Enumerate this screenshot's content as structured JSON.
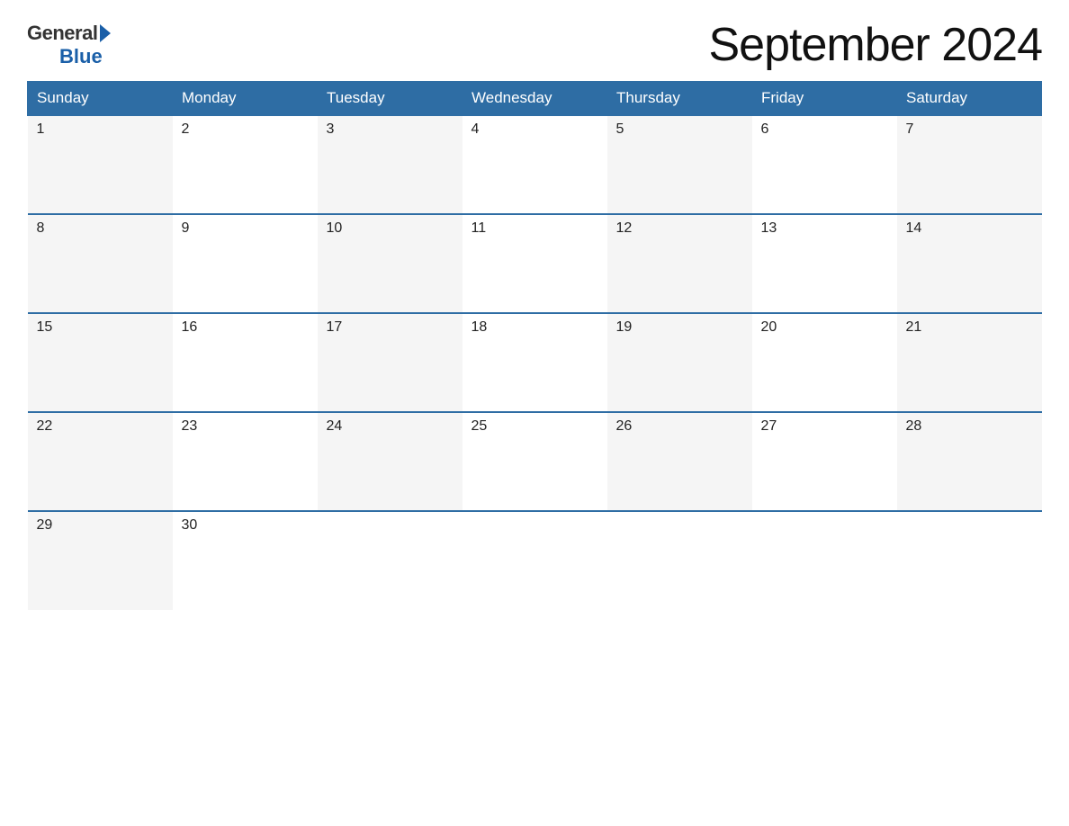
{
  "logo": {
    "general_text": "General",
    "blue_text": "Blue",
    "bottom_blue": "Blue"
  },
  "title": "September 2024",
  "days_of_week": [
    "Sunday",
    "Monday",
    "Tuesday",
    "Wednesday",
    "Thursday",
    "Friday",
    "Saturday"
  ],
  "weeks": [
    [
      {
        "day": "1",
        "empty": false
      },
      {
        "day": "2",
        "empty": false
      },
      {
        "day": "3",
        "empty": false
      },
      {
        "day": "4",
        "empty": false
      },
      {
        "day": "5",
        "empty": false
      },
      {
        "day": "6",
        "empty": false
      },
      {
        "day": "7",
        "empty": false
      }
    ],
    [
      {
        "day": "8",
        "empty": false
      },
      {
        "day": "9",
        "empty": false
      },
      {
        "day": "10",
        "empty": false
      },
      {
        "day": "11",
        "empty": false
      },
      {
        "day": "12",
        "empty": false
      },
      {
        "day": "13",
        "empty": false
      },
      {
        "day": "14",
        "empty": false
      }
    ],
    [
      {
        "day": "15",
        "empty": false
      },
      {
        "day": "16",
        "empty": false
      },
      {
        "day": "17",
        "empty": false
      },
      {
        "day": "18",
        "empty": false
      },
      {
        "day": "19",
        "empty": false
      },
      {
        "day": "20",
        "empty": false
      },
      {
        "day": "21",
        "empty": false
      }
    ],
    [
      {
        "day": "22",
        "empty": false
      },
      {
        "day": "23",
        "empty": false
      },
      {
        "day": "24",
        "empty": false
      },
      {
        "day": "25",
        "empty": false
      },
      {
        "day": "26",
        "empty": false
      },
      {
        "day": "27",
        "empty": false
      },
      {
        "day": "28",
        "empty": false
      }
    ],
    [
      {
        "day": "29",
        "empty": false
      },
      {
        "day": "30",
        "empty": false
      },
      {
        "day": "",
        "empty": true
      },
      {
        "day": "",
        "empty": true
      },
      {
        "day": "",
        "empty": true
      },
      {
        "day": "",
        "empty": true
      },
      {
        "day": "",
        "empty": true
      }
    ]
  ]
}
